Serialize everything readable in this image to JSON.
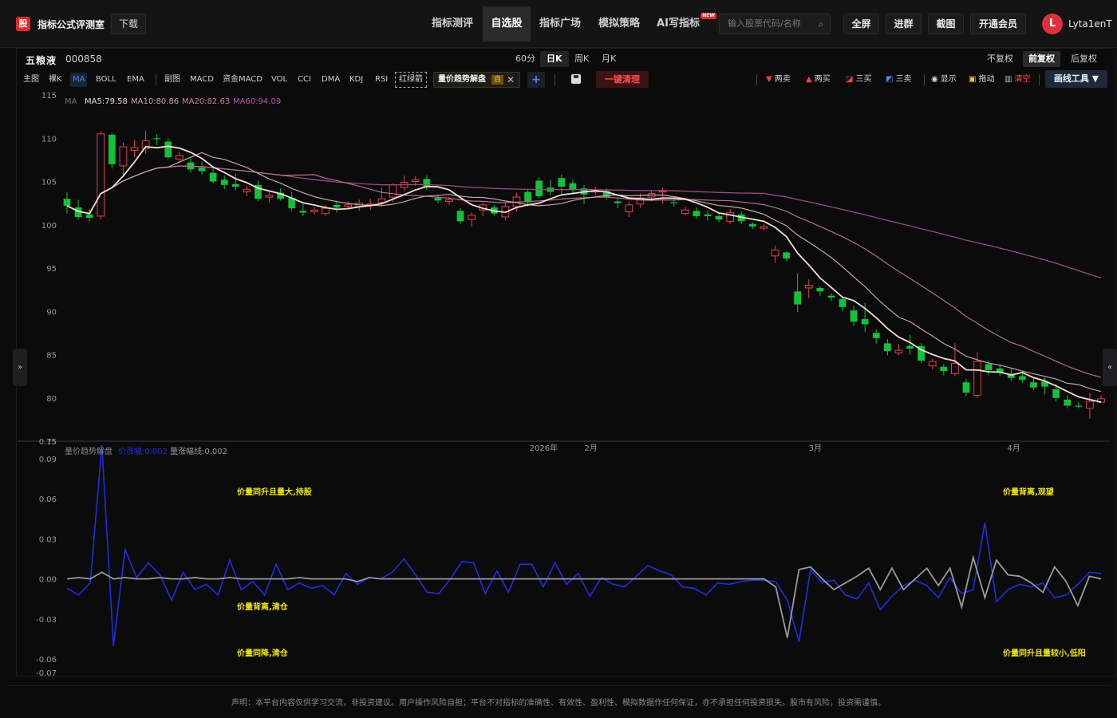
{
  "app": {
    "logo": "股",
    "title": "指标公式评测室",
    "download": "下载"
  },
  "nav": {
    "items": [
      {
        "label": "指标测评"
      },
      {
        "label": "自选股"
      },
      {
        "label": "指标广场"
      },
      {
        "label": "模拟策略"
      },
      {
        "label": "AI写指标"
      }
    ],
    "new_badge": "NEW",
    "active_index": 1
  },
  "search": {
    "placeholder": "输入股票代码/名称"
  },
  "top_buttons": {
    "fullscreen": "全屏",
    "group": "进群",
    "screenshot": "截图",
    "member": "开通会员"
  },
  "user": {
    "initial": "L",
    "name": "Lyta1enT"
  },
  "stock": {
    "name": "五粮液",
    "code": "000858"
  },
  "periods": [
    {
      "label": "60分"
    },
    {
      "label": "日K"
    },
    {
      "label": "周K"
    },
    {
      "label": "月K"
    }
  ],
  "adjust": [
    {
      "label": "不复权"
    },
    {
      "label": "前复权"
    },
    {
      "label": "后复权"
    }
  ],
  "toolbar": {
    "main_label": "主图",
    "items": [
      "裸K",
      "MA",
      "BOLL",
      "EMA"
    ],
    "sub_label": "副图",
    "sub_items": [
      "MACD",
      "资金MACD",
      "VOL",
      "CCI",
      "DMA",
      "KDJ",
      "RSI"
    ],
    "red_green": "红绿箭",
    "indicator_tag": "量价趋势解盘",
    "indicator_self": "自",
    "one_click_clear": "一键清理",
    "draw": {
      "two_sell": "两卖",
      "two_buy": "两买",
      "three_buy": "三买",
      "three_sell": "三卖",
      "show": "显示",
      "drag": "拖动",
      "clear": "清空",
      "tools": "画线工具 ▼"
    }
  },
  "ma_legend": {
    "title": "MA",
    "ma5": "MA5:79.58",
    "ma10": "MA10:80.86",
    "ma20": "MA20:82.63",
    "ma60": "MA60:94.09"
  },
  "indicator_legend": {
    "title": "量价趋势解盘",
    "price_rise": "价涨幅:0.002",
    "vol_rise": "量涨幅线:0.002"
  },
  "annotations": {
    "a1": "价量同升且量大,持股",
    "a2": "价量背离,清仓",
    "a3": "价量同降,清仓",
    "a4": "价量背离,观望",
    "a5": "价量同升且量较小,低阳"
  },
  "footer": "声明：本平台内容仅供学习交流，非投资建议。用户操作风险自担；平台不对指标的准确性、有效性、盈利性、模拟数据作任何保证，亦不承担任何投资损失。股市有风险，投资需谨慎。",
  "colors": {
    "up": "#e0434b",
    "down": "#16c13a",
    "ma5": "#f0ddd0",
    "ma10": "#c8a4a8",
    "ma20": "#b07090",
    "ma60": "#9a4a86",
    "price_line": "#1f2ee0",
    "vol_line": "#9a9a9a",
    "annotation": "#f2e600"
  },
  "chart_data": {
    "type": "candlestick",
    "price_axis": {
      "ticks": [
        115,
        110,
        105,
        100,
        95,
        90,
        85,
        80,
        75
      ],
      "range": [
        75,
        115
      ]
    },
    "time_labels": [
      "2026年",
      "2月",
      "3月",
      "4月"
    ],
    "candles": [
      [
        103.0,
        102.2,
        103.8,
        101.3
      ],
      [
        102.0,
        100.9,
        102.9,
        100.6
      ],
      [
        101.2,
        100.8,
        101.8,
        100.4
      ],
      [
        101.0,
        110.5,
        110.8,
        100.6
      ],
      [
        110.4,
        107.0,
        110.6,
        106.5
      ],
      [
        106.8,
        109.0,
        109.5,
        105.8
      ],
      [
        108.6,
        108.9,
        109.8,
        107.8
      ],
      [
        108.8,
        109.7,
        110.9,
        108.2
      ],
      [
        110.0,
        109.9,
        110.5,
        109.2
      ],
      [
        109.6,
        107.8,
        110.0,
        107.6
      ],
      [
        107.6,
        108.0,
        108.4,
        107.1
      ],
      [
        107.2,
        106.4,
        107.7,
        106.0
      ],
      [
        106.6,
        106.2,
        107.3,
        105.8
      ],
      [
        106.0,
        105.0,
        106.5,
        104.8
      ],
      [
        105.2,
        104.6,
        105.7,
        104.1
      ],
      [
        104.7,
        104.4,
        105.9,
        104.0
      ],
      [
        103.8,
        104.1,
        104.5,
        103.3
      ],
      [
        104.6,
        103.0,
        105.1,
        102.7
      ],
      [
        103.2,
        103.4,
        103.9,
        102.6
      ],
      [
        103.7,
        103.0,
        104.2,
        102.8
      ],
      [
        103.1,
        101.9,
        103.8,
        101.6
      ],
      [
        101.6,
        101.4,
        102.4,
        101.0
      ],
      [
        101.5,
        101.7,
        102.1,
        101.2
      ],
      [
        101.3,
        101.9,
        102.3,
        101.0
      ],
      [
        102.3,
        102.0,
        102.8,
        101.4
      ],
      [
        102.1,
        102.3,
        102.7,
        101.8
      ],
      [
        102.1,
        102.5,
        102.9,
        101.6
      ],
      [
        102.3,
        102.4,
        103.0,
        101.7
      ],
      [
        102.6,
        103.0,
        104.3,
        102.2
      ],
      [
        103.2,
        104.6,
        104.8,
        102.6
      ],
      [
        104.3,
        104.9,
        105.7,
        103.9
      ],
      [
        105.0,
        105.2,
        105.6,
        104.5
      ],
      [
        105.3,
        104.4,
        105.7,
        104.0
      ],
      [
        103.1,
        102.8,
        103.4,
        102.5
      ],
      [
        102.7,
        102.9,
        103.2,
        102.3
      ],
      [
        101.6,
        100.4,
        101.9,
        100.1
      ],
      [
        100.6,
        101.1,
        101.4,
        99.8
      ],
      [
        101.7,
        102.3,
        102.6,
        101.0
      ],
      [
        102.0,
        101.3,
        102.3,
        101.0
      ],
      [
        100.9,
        102.1,
        102.6,
        100.5
      ],
      [
        102.1,
        103.2,
        103.7,
        101.5
      ],
      [
        103.8,
        102.6,
        104.0,
        102.1
      ],
      [
        105.1,
        103.3,
        105.5,
        103.0
      ],
      [
        104.3,
        103.8,
        105.2,
        103.4
      ],
      [
        105.4,
        104.4,
        105.8,
        103.6
      ],
      [
        104.8,
        104.0,
        105.2,
        103.5
      ],
      [
        104.2,
        103.5,
        104.6,
        102.4
      ],
      [
        103.8,
        103.9,
        104.4,
        103.4
      ],
      [
        103.9,
        103.2,
        104.2,
        102.9
      ],
      [
        102.7,
        102.5,
        103.1,
        101.9
      ],
      [
        101.5,
        102.3,
        102.7,
        100.9
      ],
      [
        102.4,
        103.1,
        103.6,
        102.0
      ],
      [
        103.2,
        103.6,
        104.0,
        102.7
      ],
      [
        103.8,
        103.9,
        104.3,
        102.4
      ],
      [
        102.6,
        102.5,
        103.0,
        102.1
      ],
      [
        101.3,
        101.7,
        102.1,
        101.1
      ],
      [
        101.6,
        101.0,
        102.0,
        100.7
      ],
      [
        101.2,
        101.0,
        101.6,
        100.5
      ],
      [
        101.0,
        100.6,
        101.3,
        100.3
      ],
      [
        100.4,
        101.4,
        101.8,
        100.1
      ],
      [
        101.2,
        100.4,
        101.5,
        100.1
      ],
      [
        100.1,
        99.8,
        100.3,
        99.5
      ],
      [
        99.6,
        99.8,
        100.1,
        99.3
      ],
      [
        96.4,
        97.1,
        97.6,
        95.6
      ],
      [
        96.8,
        96.1,
        96.9,
        95.8
      ],
      [
        92.3,
        90.8,
        94.4,
        89.9
      ],
      [
        92.7,
        93.0,
        93.7,
        91.5
      ],
      [
        92.7,
        92.3,
        92.9,
        91.8
      ],
      [
        91.8,
        91.6,
        92.1,
        91.2
      ],
      [
        91.4,
        90.5,
        91.6,
        90.0
      ],
      [
        90.1,
        88.8,
        90.6,
        88.3
      ],
      [
        89.1,
        88.5,
        91.0,
        87.6
      ],
      [
        87.5,
        86.9,
        87.9,
        86.3
      ],
      [
        86.3,
        85.4,
        86.8,
        84.9
      ],
      [
        85.2,
        85.5,
        86.2,
        84.9
      ],
      [
        86.0,
        85.7,
        87.3,
        85.0
      ],
      [
        86.0,
        84.3,
        86.3,
        84.0
      ],
      [
        83.7,
        84.2,
        84.5,
        83.3
      ],
      [
        83.6,
        83.1,
        83.9,
        82.6
      ],
      [
        82.8,
        84.0,
        86.3,
        82.5
      ],
      [
        81.8,
        80.6,
        82.2,
        80.2
      ],
      [
        80.3,
        84.2,
        85.3,
        80.0
      ],
      [
        83.9,
        83.2,
        84.3,
        82.6
      ],
      [
        83.4,
        82.9,
        83.9,
        82.5
      ],
      [
        82.8,
        82.3,
        83.4,
        82.0
      ],
      [
        82.5,
        82.1,
        82.9,
        81.7
      ],
      [
        81.8,
        81.2,
        82.3,
        80.9
      ],
      [
        81.9,
        81.3,
        82.4,
        80.4
      ],
      [
        81.0,
        80.0,
        81.6,
        79.6
      ],
      [
        79.8,
        79.1,
        80.3,
        78.8
      ],
      [
        79.1,
        79.0,
        79.5,
        78.8
      ],
      [
        78.8,
        79.6,
        80.6,
        77.6
      ],
      [
        79.5,
        79.9,
        80.3,
        79.4
      ]
    ],
    "ma_latest": {
      "ma5": 79.58,
      "ma10": 80.86,
      "ma20": 82.63,
      "ma60": 94.09
    },
    "indicator_axis": {
      "ticks": [
        0.15,
        0.09,
        0.06,
        0.03,
        0.0,
        -0.03,
        -0.06,
        -0.07
      ],
      "range": [
        -0.07,
        0.1
      ]
    },
    "price_change": [
      -0.007,
      -0.012,
      -0.003,
      0.1,
      -0.05,
      0.022,
      0.001,
      0.012,
      0.003,
      -0.016,
      0.005,
      -0.008,
      -0.004,
      -0.012,
      0.014,
      -0.008,
      -0.002,
      -0.012,
      0.011,
      -0.008,
      -0.003,
      -0.007,
      -0.005,
      -0.012,
      0.004,
      -0.004,
      0.001,
      0.0,
      0.005,
      0.015,
      0.003,
      -0.01,
      -0.011,
      0.0,
      0.013,
      0.012,
      -0.011,
      0.006,
      -0.01,
      0.011,
      0.011,
      -0.006,
      0.012,
      -0.004,
      0.004,
      -0.013,
      0.001,
      -0.004,
      -0.006,
      0.002,
      0.01,
      0.006,
      0.003,
      -0.006,
      -0.007,
      -0.012,
      -0.003,
      -0.004,
      -0.002,
      -0.001,
      -0.001,
      -0.002,
      -0.016,
      -0.047,
      0.007,
      -0.003,
      -0.001,
      -0.012,
      -0.015,
      -0.003,
      -0.023,
      -0.013,
      -0.005,
      -0.001,
      -0.005,
      -0.014,
      0.001,
      -0.011,
      -0.008,
      0.042,
      -0.017,
      -0.008,
      -0.004,
      -0.006,
      -0.003,
      -0.014,
      -0.012,
      -0.004,
      0.005,
      0.004
    ],
    "volume_change": [
      0.0,
      0.001,
      0.0,
      0.005,
      0.0,
      0.001,
      0.0,
      0.0,
      0.001,
      0.0,
      0.0,
      0.001,
      0.0,
      0.0,
      0.001,
      0.0,
      0.0,
      0.0,
      0.0,
      0.0,
      0.001,
      0.0,
      0.0,
      0.0,
      0.0,
      -0.002,
      0.001,
      0.0,
      0.0,
      0.0,
      0.0,
      0.0,
      0.0,
      0.0,
      0.0,
      0.0,
      0.0,
      0.0,
      0.0,
      0.0,
      0.0,
      0.0,
      0.0,
      0.0,
      0.0,
      0.0,
      0.0,
      0.0,
      0.0,
      0.0,
      0.0,
      0.0,
      0.0,
      0.0,
      0.0,
      0.0,
      0.0,
      0.0,
      0.0,
      0.0,
      0.0,
      -0.006,
      -0.044,
      0.007,
      0.009,
      0.0,
      -0.008,
      -0.003,
      0.002,
      0.008,
      -0.008,
      0.008,
      -0.008,
      0.0,
      0.008,
      -0.005,
      0.008,
      -0.021,
      0.016,
      -0.014,
      0.014,
      0.003,
      0.002,
      -0.003,
      -0.01,
      0.009,
      -0.002,
      -0.02,
      0.002,
      0.0
    ]
  }
}
